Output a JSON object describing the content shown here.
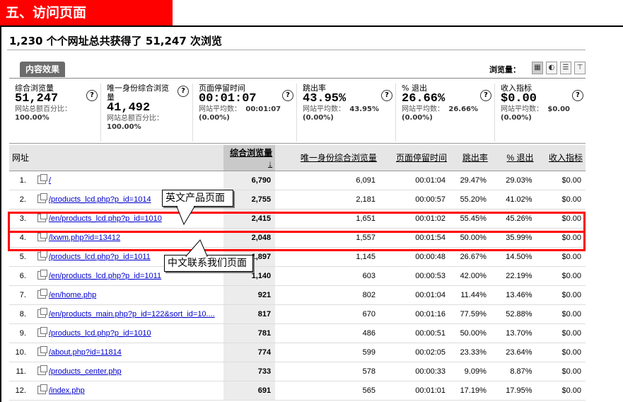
{
  "section_header": "五、访问页面",
  "headline": "1,230 个个网址总共获得了  51,247 次浏览",
  "tab": "内容效果",
  "view_label": "浏览量：",
  "view_icons": [
    "grid-view-icon",
    "pie-view-icon",
    "bar-view-icon",
    "compare-view-icon"
  ],
  "summary": [
    {
      "label": "综合浏览量",
      "value": "51,247",
      "sub_label": "网站总额百分比：",
      "sub_value": "100.00%"
    },
    {
      "label": "唯一身份综合浏览量",
      "value": "41,492",
      "sub_label": "网站总额百分比：",
      "sub_value": "100.00%"
    },
    {
      "label": "页面停留时间",
      "value": "00:01:07",
      "sub_label": "网站平均数：",
      "sub_value": "00:01:07",
      "sub_extra": "(0.00%)"
    },
    {
      "label": "跳出率",
      "value": "43.95%",
      "sub_label": "网站平均数：",
      "sub_value": "43.95%",
      "sub_extra": "(0.00%)"
    },
    {
      "label": "% 退出",
      "value": "26.66%",
      "sub_label": "网站平均数：",
      "sub_value": "26.66%",
      "sub_extra": "(0.00%)"
    },
    {
      "label": "收入指标",
      "value": "$0.00",
      "sub_label": "网站平均数：",
      "sub_value": "$0.00",
      "sub_extra": "(0.00%)"
    }
  ],
  "help_icon_glyph": "?",
  "table": {
    "headers": [
      "网址",
      "综合浏览量",
      "唯一身份综合浏览量",
      "页面停留时间",
      "跳出率",
      "% 退出",
      "收入指标"
    ],
    "sort_arrow": "↓",
    "rows": [
      {
        "idx": "1.",
        "url": "/",
        "pv": "6,790",
        "upv": "6,091",
        "time": "00:01:04",
        "bounce": "29.47%",
        "exit": "29.03%",
        "rev": "$0.00"
      },
      {
        "idx": "2.",
        "url": "/products_lcd.php?p_id=1014",
        "pv": "2,755",
        "upv": "2,181",
        "time": "00:00:57",
        "bounce": "55.20%",
        "exit": "41.02%",
        "rev": "$0.00"
      },
      {
        "idx": "3.",
        "url": "/en/products_lcd.php?p_id=1010",
        "pv": "2,415",
        "upv": "1,651",
        "time": "00:01:02",
        "bounce": "55.45%",
        "exit": "45.26%",
        "rev": "$0.00"
      },
      {
        "idx": "4.",
        "url": "/lxwm.php?id=13412",
        "pv": "2,048",
        "upv": "1,557",
        "time": "00:01:54",
        "bounce": "50.00%",
        "exit": "35.99%",
        "rev": "$0.00"
      },
      {
        "idx": "5.",
        "url": "/products_lcd.php?p_id=1011",
        "pv": "1,897",
        "upv": "1,145",
        "time": "00:00:48",
        "bounce": "26.67%",
        "exit": "14.50%",
        "rev": "$0.00"
      },
      {
        "idx": "6.",
        "url": "/en/products_lcd.php?p_id=1011",
        "pv": "1,140",
        "upv": "603",
        "time": "00:00:53",
        "bounce": "42.00%",
        "exit": "22.19%",
        "rev": "$0.00"
      },
      {
        "idx": "7.",
        "url": "/en/home.php",
        "pv": "921",
        "upv": "802",
        "time": "00:01:04",
        "bounce": "11.44%",
        "exit": "13.46%",
        "rev": "$0.00"
      },
      {
        "idx": "8.",
        "url": "/en/products_main.php?p_id=122&sort_id=10....",
        "pv": "817",
        "upv": "670",
        "time": "00:01:16",
        "bounce": "77.59%",
        "exit": "52.88%",
        "rev": "$0.00"
      },
      {
        "idx": "9.",
        "url": "/products_lcd.php?p_id=1010",
        "pv": "781",
        "upv": "486",
        "time": "00:00:51",
        "bounce": "50.00%",
        "exit": "13.70%",
        "rev": "$0.00"
      },
      {
        "idx": "10.",
        "url": "/about.php?id=11814",
        "pv": "774",
        "upv": "599",
        "time": "00:02:05",
        "bounce": "23.33%",
        "exit": "23.64%",
        "rev": "$0.00"
      },
      {
        "idx": "11.",
        "url": "/products_center.php",
        "pv": "733",
        "upv": "578",
        "time": "00:00:33",
        "bounce": "9.09%",
        "exit": "8.87%",
        "rev": "$0.00"
      },
      {
        "idx": "12.",
        "url": "/index.php",
        "pv": "691",
        "upv": "565",
        "time": "00:01:01",
        "bounce": "17.19%",
        "exit": "17.95%",
        "rev": "$0.00"
      }
    ]
  },
  "callouts": {
    "english": "英文产品页面",
    "chinese": "中文联系我们页面"
  },
  "colors": {
    "highlight": "#ff0000",
    "header_bg": "#ff0000",
    "link": "#0000cc"
  }
}
